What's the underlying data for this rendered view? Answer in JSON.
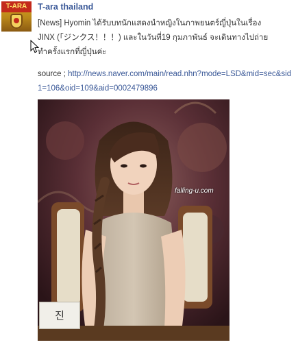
{
  "post": {
    "author": "T-ara thailand",
    "avatar_logo_text": "T-ARA",
    "message": "[News] Hyomin ได้รับบทนักแสดงนำหญิงในภาพยนตร์ญี่ปุ่นในเรื่อง\nJINX (「ジンクス！！！) และในวันที่19 กุมภาพันธ์ จะเดินทางไปถ่าย\nทำครั้งแรกที่ญี่ปุ่นค่ะ",
    "source_label": "source ; ",
    "source_url": "http://news.naver.com/main/read.nhn?mode=LSD&mid=sec&sid1=106&oid=109&aid=0002479896",
    "photo": {
      "watermark": "falling-u.com",
      "nameplate": "진"
    }
  },
  "colors": {
    "link": "#3b5998",
    "text": "#333333"
  },
  "icons": {
    "cursor": "mouse-pointer-icon"
  }
}
